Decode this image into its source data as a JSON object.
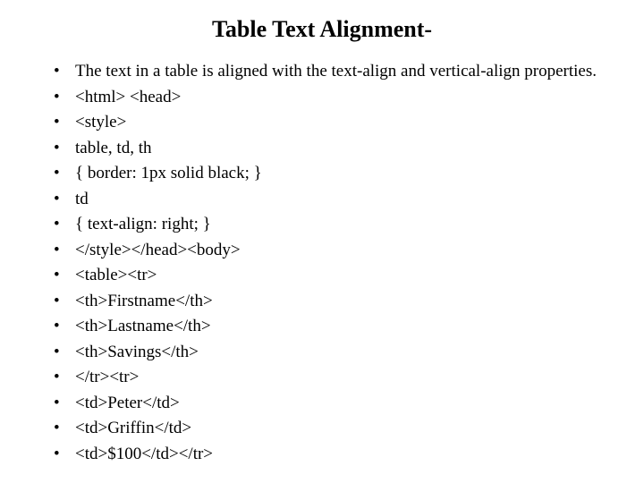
{
  "title": "Table Text Alignment-",
  "bullets": [
    "The text in a table is aligned with the text-align and vertical-align properties.",
    "<html> <head>",
    "<style>",
    "table, td, th",
    "{  border: 1px solid black; }",
    "td",
    "{ text-align: right; }",
    "</style></head><body>",
    "<table><tr>",
    "<th>Firstname</th>",
    "<th>Lastname</th>",
    "<th>Savings</th>",
    "</tr><tr>",
    "<td>Peter</td>",
    "<td>Griffin</td>",
    "<td>$100</td></tr>"
  ]
}
